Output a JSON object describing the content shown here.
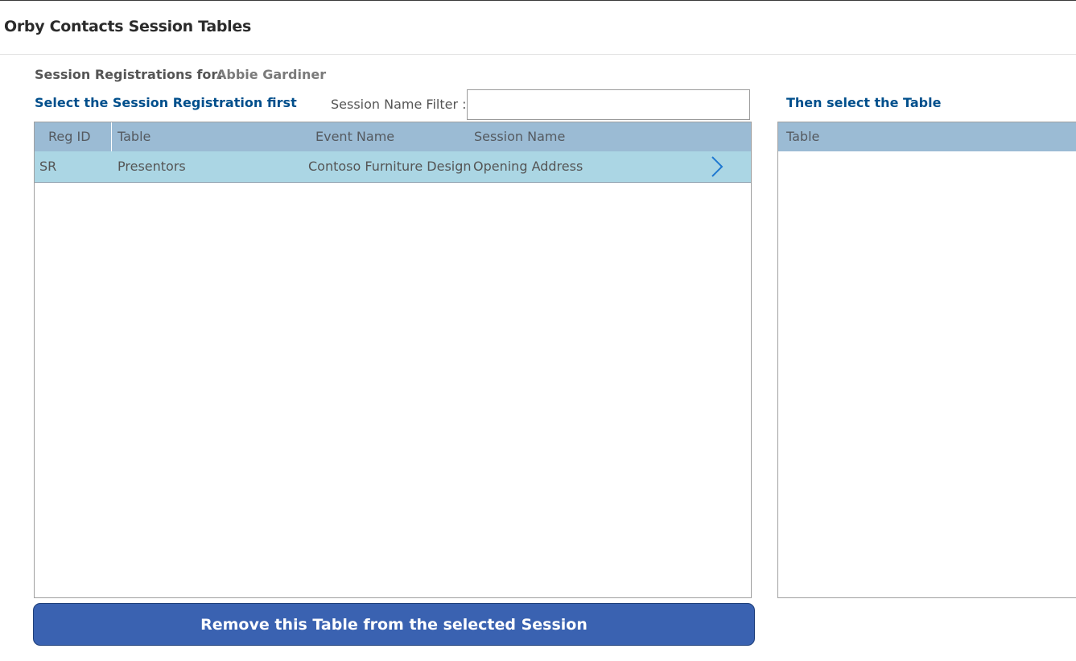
{
  "app": {
    "title": "Orby Contacts Session Tables"
  },
  "registration": {
    "label": "Session Registrations for:",
    "name": "Abbie Gardiner"
  },
  "left_panel": {
    "heading": "Select the Session Registration first",
    "filter": {
      "label": "Session Name Filter :",
      "value": "",
      "placeholder": ""
    },
    "columns": [
      "Reg ID",
      "Table",
      "Event Name",
      "Session Name"
    ],
    "rows": [
      {
        "reg_id": "SR",
        "table": "Presentors",
        "event_name": "Contoso Furniture Design",
        "session_name": "Opening Address",
        "selected": true
      }
    ]
  },
  "right_panel": {
    "heading": "Then select the Table",
    "columns": [
      "Table"
    ]
  },
  "actions": {
    "remove_label": "Remove this Table from the selected Session"
  },
  "colors": {
    "heading_blue": "#004f8c",
    "header_bg": "#9bbbd4",
    "selected_row_bg": "#abd6e4",
    "button_bg": "#3a62b1",
    "chevron": "#1f78d1"
  }
}
